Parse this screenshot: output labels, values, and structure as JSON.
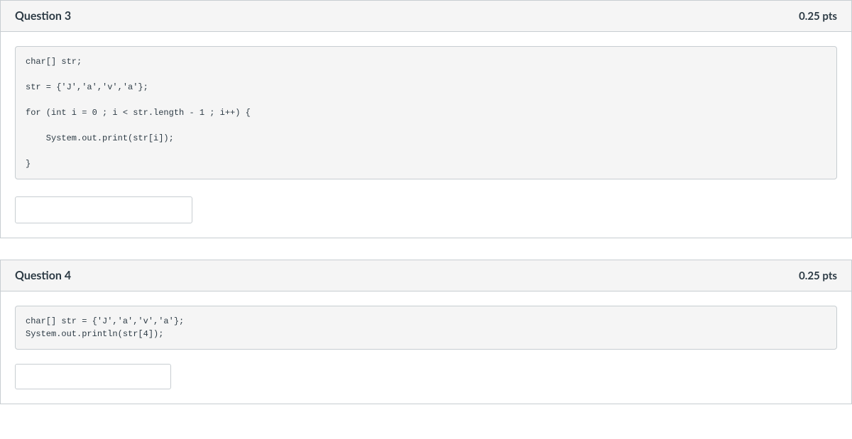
{
  "questions": [
    {
      "title": "Question 3",
      "points": "0.25 pts",
      "code": "char[] str;\n\nstr = {'J','a','v','a'};\n\nfor (int i = 0 ; i < str.length - 1 ; i++) {\n\n    System.out.print(str[i]);\n\n}",
      "answer": ""
    },
    {
      "title": "Question 4",
      "points": "0.25 pts",
      "code": "char[] str = {'J','a','v','a'};\nSystem.out.println(str[4]);",
      "answer": ""
    }
  ]
}
